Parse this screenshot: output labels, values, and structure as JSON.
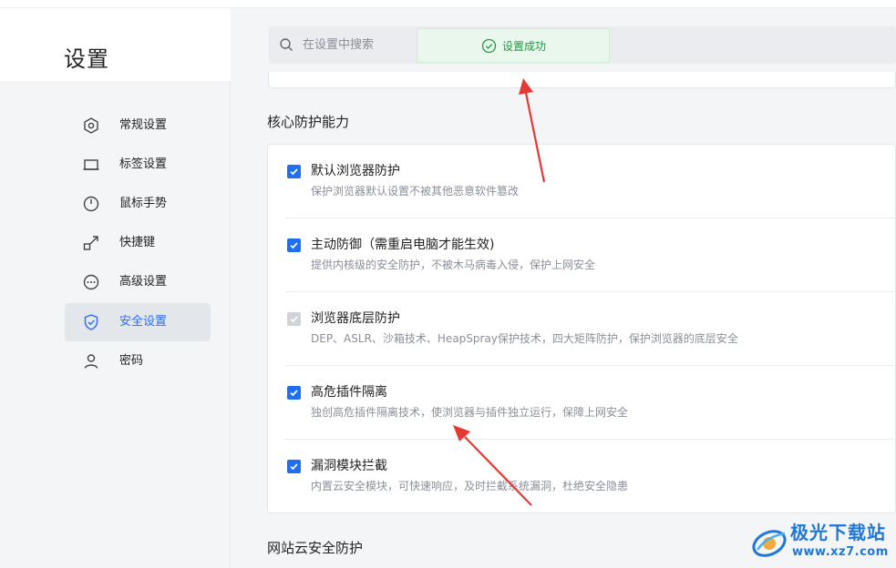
{
  "page_title": "设置",
  "sidebar": {
    "items": [
      {
        "label": "常规设置",
        "icon": "hexagon-gear-icon",
        "active": false
      },
      {
        "label": "标签设置",
        "icon": "tab-icon",
        "active": false
      },
      {
        "label": "鼠标手势",
        "icon": "mouse-icon",
        "active": false
      },
      {
        "label": "快捷键",
        "icon": "shortcut-arrow-icon",
        "active": false
      },
      {
        "label": "高级设置",
        "icon": "more-circle-icon",
        "active": false
      },
      {
        "label": "安全设置",
        "icon": "shield-check-icon",
        "active": true
      },
      {
        "label": "密码",
        "icon": "user-icon",
        "active": false
      }
    ]
  },
  "search": {
    "placeholder": "在设置中搜索"
  },
  "toast": {
    "text": "设置成功",
    "color": "#1f9a45"
  },
  "sections": {
    "core": {
      "title": "核心防护能力",
      "options": [
        {
          "title": "默认浏览器防护",
          "desc": "保护浏览器默认设置不被其他恶意软件篡改",
          "checked": true,
          "disabled": false
        },
        {
          "title": "主动防御（需重启电脑才能生效)",
          "desc": "提供内核级的安全防护，不被木马病毒入侵，保护上网安全",
          "checked": true,
          "disabled": false
        },
        {
          "title": "浏览器底层防护",
          "desc": "DEP、ASLR、沙箱技术、HeapSpray保护技术，四大矩阵防护，保护浏览器的底层安全",
          "checked": true,
          "disabled": true
        },
        {
          "title": "高危插件隔离",
          "desc": "独创高危插件隔离技术，使浏览器与插件独立运行，保障上网安全",
          "checked": true,
          "disabled": false
        },
        {
          "title": "漏洞模块拦截",
          "desc": "内置云安全模块，可快速响应，及时拦截系统漏洞，杜绝安全隐患",
          "checked": true,
          "disabled": false
        }
      ]
    },
    "cloud": {
      "title": "网站云安全防护"
    }
  },
  "watermark": {
    "cn": "极光下载站",
    "url": "www.xz7.com"
  },
  "colors": {
    "accent": "#1f6ff0",
    "arrow": "#e53935",
    "toast_bg": "#e9f7ec"
  }
}
